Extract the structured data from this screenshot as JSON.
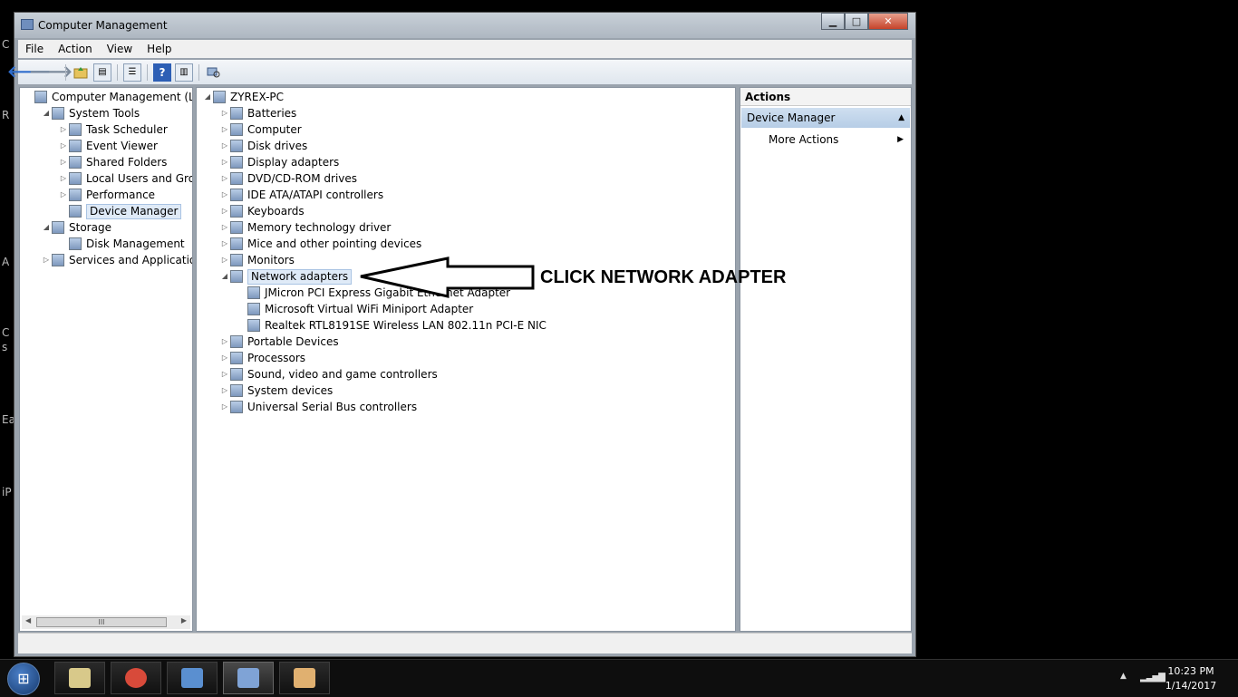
{
  "desktop_fragments": [
    "C",
    "R",
    "A",
    "C",
    "s",
    "Ea",
    "iP"
  ],
  "window": {
    "title": "Computer Management",
    "controls": {
      "minimize": "▁",
      "maximize": "□",
      "close": "✕"
    }
  },
  "menu": [
    "File",
    "Action",
    "View",
    "Help"
  ],
  "toolbar_icons": [
    "back-arrow-icon",
    "forward-arrow-icon",
    "up-folder-icon",
    "show-hide-console-tree-icon",
    "properties-icon",
    "help-icon",
    "show-hide-action-pane-icon",
    "scan-hardware-icon"
  ],
  "left_tree": [
    {
      "label": "Computer Management (Local",
      "level": 0,
      "expander": "",
      "icon": "computer-management-icon"
    },
    {
      "label": "System Tools",
      "level": 1,
      "expander": "◢",
      "icon": "system-tools-icon"
    },
    {
      "label": "Task Scheduler",
      "level": 2,
      "expander": "▷",
      "icon": "task-scheduler-icon"
    },
    {
      "label": "Event Viewer",
      "level": 2,
      "expander": "▷",
      "icon": "event-viewer-icon"
    },
    {
      "label": "Shared Folders",
      "level": 2,
      "expander": "▷",
      "icon": "shared-folders-icon"
    },
    {
      "label": "Local Users and Groups",
      "level": 2,
      "expander": "▷",
      "icon": "local-users-icon"
    },
    {
      "label": "Performance",
      "level": 2,
      "expander": "▷",
      "icon": "performance-icon"
    },
    {
      "label": "Device Manager",
      "level": 2,
      "expander": "",
      "icon": "device-manager-icon",
      "selected": true
    },
    {
      "label": "Storage",
      "level": 1,
      "expander": "◢",
      "icon": "storage-icon"
    },
    {
      "label": "Disk Management",
      "level": 2,
      "expander": "",
      "icon": "disk-management-icon"
    },
    {
      "label": "Services and Applications",
      "level": 1,
      "expander": "▷",
      "icon": "services-icon"
    }
  ],
  "left_scrollbar": {
    "grip": "III",
    "left": "◀",
    "right": "▶"
  },
  "device_tree": [
    {
      "label": "ZYREX-PC",
      "level": 0,
      "expander": "◢",
      "icon": "computer-icon"
    },
    {
      "label": "Batteries",
      "level": 1,
      "expander": "▷",
      "icon": "battery-icon"
    },
    {
      "label": "Computer",
      "level": 1,
      "expander": "▷",
      "icon": "computer-icon"
    },
    {
      "label": "Disk drives",
      "level": 1,
      "expander": "▷",
      "icon": "disk-drive-icon"
    },
    {
      "label": "Display adapters",
      "level": 1,
      "expander": "▷",
      "icon": "display-adapter-icon"
    },
    {
      "label": "DVD/CD-ROM drives",
      "level": 1,
      "expander": "▷",
      "icon": "dvd-drive-icon"
    },
    {
      "label": "IDE ATA/ATAPI controllers",
      "level": 1,
      "expander": "▷",
      "icon": "ide-controller-icon"
    },
    {
      "label": "Keyboards",
      "level": 1,
      "expander": "▷",
      "icon": "keyboard-icon"
    },
    {
      "label": "Memory technology driver",
      "level": 1,
      "expander": "▷",
      "icon": "memory-icon"
    },
    {
      "label": "Mice and other pointing devices",
      "level": 1,
      "expander": "▷",
      "icon": "mouse-icon"
    },
    {
      "label": "Monitors",
      "level": 1,
      "expander": "▷",
      "icon": "monitor-icon"
    },
    {
      "label": "Network adapters",
      "level": 1,
      "expander": "◢",
      "icon": "network-adapter-icon",
      "selected": true
    },
    {
      "label": "JMicron PCI Express Gigabit Ethernet Adapter",
      "level": 2,
      "expander": "",
      "icon": "network-adapter-icon"
    },
    {
      "label": "Microsoft Virtual WiFi Miniport Adapter",
      "level": 2,
      "expander": "",
      "icon": "network-adapter-icon"
    },
    {
      "label": "Realtek RTL8191SE Wireless LAN 802.11n PCI-E NIC",
      "level": 2,
      "expander": "",
      "icon": "network-adapter-icon"
    },
    {
      "label": "Portable Devices",
      "level": 1,
      "expander": "▷",
      "icon": "portable-device-icon"
    },
    {
      "label": "Processors",
      "level": 1,
      "expander": "▷",
      "icon": "processor-icon"
    },
    {
      "label": "Sound, video and game controllers",
      "level": 1,
      "expander": "▷",
      "icon": "sound-icon"
    },
    {
      "label": "System devices",
      "level": 1,
      "expander": "▷",
      "icon": "system-device-icon"
    },
    {
      "label": "Universal Serial Bus controllers",
      "level": 1,
      "expander": "▷",
      "icon": "usb-icon"
    }
  ],
  "actions": {
    "header": "Actions",
    "section": "Device Manager",
    "section_caret": "▲",
    "items": [
      {
        "label": "More Actions",
        "arrow": "▶"
      }
    ]
  },
  "annotation": {
    "text": "CLICK NETWORK ADAPTER"
  },
  "taskbar": {
    "start": "⊞",
    "buttons": [
      {
        "name": "taskbar-explorer-button",
        "icon": "file-explorer-icon",
        "color": "#d8c98a",
        "active": false
      },
      {
        "name": "taskbar-chrome-button",
        "icon": "chrome-icon",
        "color": "#d84a3a",
        "active": false
      },
      {
        "name": "taskbar-control-panel-button",
        "icon": "control-panel-icon",
        "color": "#5a8fd0",
        "active": false
      },
      {
        "name": "taskbar-computer-management-button",
        "icon": "computer-management-icon",
        "color": "#7fa3d6",
        "active": true
      },
      {
        "name": "taskbar-paint-button",
        "icon": "paint-icon",
        "color": "#e0b070",
        "active": false
      }
    ],
    "tray_up": "▲",
    "signal": "▂▃▅▇",
    "time": "10:23 PM",
    "date": "1/14/2017"
  }
}
